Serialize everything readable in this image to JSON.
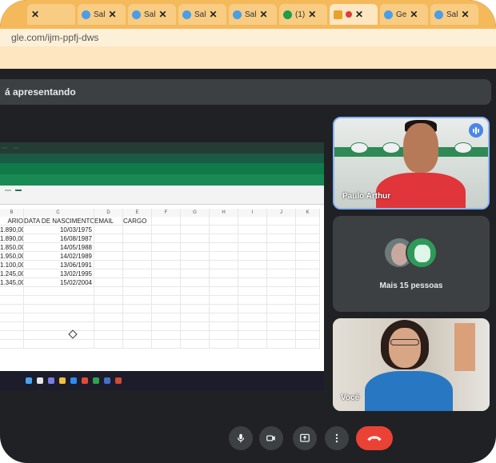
{
  "browser": {
    "tabs": [
      {
        "label": "Sal"
      },
      {
        "label": "Sal"
      },
      {
        "label": "Sal"
      },
      {
        "label": "Sal"
      },
      {
        "label": "(1)"
      },
      {
        "label": ""
      },
      {
        "label": "Ge"
      },
      {
        "label": "Sal"
      }
    ],
    "tab_close": "✕",
    "url": "gle.com/ijm-ppfj-dws"
  },
  "meet": {
    "presenting_banner": "á apresentando",
    "shared_screen": {
      "spreadsheet": {
        "column_letters": [
          "B",
          "C",
          "D",
          "E",
          "F",
          "G",
          "H",
          "I",
          "J",
          "K"
        ],
        "headers": [
          "ARIO",
          "DATA DE NASCIMENTO",
          "EMAIL",
          "CARGO"
        ],
        "rows": [
          {
            "salary": "1.890,00",
            "birth": "10/03/1975"
          },
          {
            "salary": "1.890,00",
            "birth": "16/08/1987"
          },
          {
            "salary": "1.850,00",
            "birth": "14/05/1988"
          },
          {
            "salary": "1.950,00",
            "birth": "14/02/1989"
          },
          {
            "salary": "1.100,00",
            "birth": "13/06/1991"
          },
          {
            "salary": "1.245,00",
            "birth": "13/02/1995"
          },
          {
            "salary": "1.345,00",
            "birth": "15/02/2004"
          }
        ]
      }
    },
    "participants": {
      "main": {
        "name": "Paulo Arthur"
      },
      "others_label": "Mais 15 pessoas",
      "self": {
        "name": "Você"
      }
    },
    "colors": {
      "background": "#202124",
      "tile": "#3c4043",
      "leave": "#ea4335",
      "speaking_border": "#8ab4f8"
    },
    "controls": {
      "mic_icon": "mic-icon",
      "camera_icon": "camera-icon",
      "present_icon": "present-icon",
      "more_icon": "more-vert-icon",
      "leave_icon": "phone-hangup-icon"
    }
  }
}
